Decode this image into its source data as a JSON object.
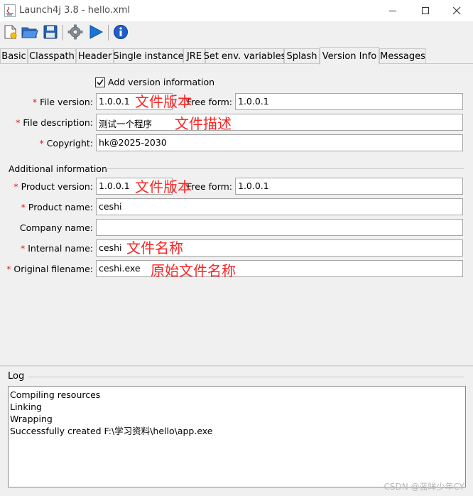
{
  "window": {
    "title": "Launch4j 3.8 - hello.xml"
  },
  "toolbar": {
    "buttons": [
      "new-config-icon",
      "open-folder-icon",
      "save-icon",
      "build-gear-icon",
      "run-icon",
      "about-info-icon"
    ]
  },
  "tabs": [
    "Basic",
    "Classpath",
    "Header",
    "Single instance",
    "JRE",
    "Set env. variables",
    "Splash",
    "Version Info",
    "Messages"
  ],
  "active_tab": "Version Info",
  "version_info": {
    "add_version_label": "Add version information",
    "add_version_checked": true,
    "file_version_label": "File version:",
    "file_version_value": "1.0.0.1",
    "file_free_form_label": "Free form:",
    "file_free_form_value": "1.0.0.1",
    "file_description_label": "File description:",
    "file_description_value": "测试一个程序",
    "copyright_label": "Copyright:",
    "copyright_value": "hk@2025-2030"
  },
  "additional": {
    "section_title": "Additional information",
    "product_version_label": "Product version:",
    "product_version_value": "1.0.0.1",
    "product_free_form_label": "Free form:",
    "product_free_form_value": "1.0.0.1",
    "product_name_label": "Product name:",
    "product_name_value": "ceshi",
    "company_name_label": "Company name:",
    "company_name_value": "",
    "internal_name_label": "Internal name:",
    "internal_name_value": "ceshi",
    "original_filename_label": "Original filename:",
    "original_filename_value": "ceshi.exe"
  },
  "annotations": {
    "file_version": "文件版本",
    "file_description": "文件描述",
    "product_version": "文件版本",
    "internal_name": "文件名称",
    "original_filename": "原始文件名称"
  },
  "log": {
    "title": "Log",
    "lines": [
      "Compiling resources",
      "Linking",
      "Wrapping",
      "Successfully created F:\\学习资料\\hello\\app.exe"
    ]
  },
  "watermark": "CSDN @蓝眸少年CY",
  "colors": {
    "required_star": "#d42020",
    "annotation_red": "#ff2222",
    "run_blue": "#1a73d6"
  }
}
